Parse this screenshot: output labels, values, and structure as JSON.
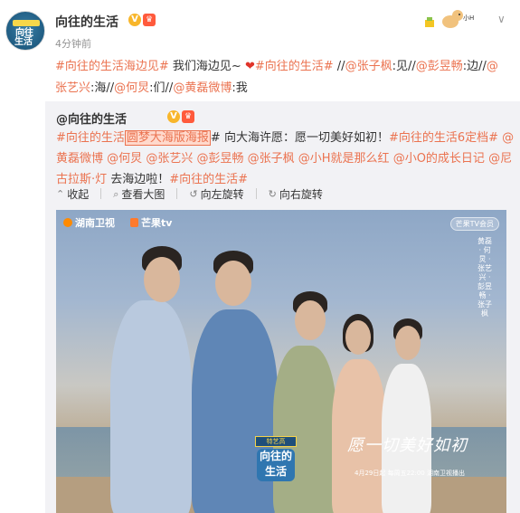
{
  "post": {
    "author": "向往的生活",
    "time": "4分钟前",
    "text": [
      {
        "t": "#向往的生活海边见#",
        "link": true
      },
      {
        "t": " 我们海边见~ ",
        "link": false
      },
      {
        "t": "❤",
        "heart": true
      },
      {
        "t": "#向往的生活#",
        "link": true
      },
      {
        "t": " //",
        "link": false
      },
      {
        "t": "@张子枫",
        "link": true
      },
      {
        "t": ":见//",
        "link": false
      },
      {
        "t": "@彭昱畅",
        "link": true
      },
      {
        "t": ":边//",
        "link": false
      },
      {
        "t": "@张艺兴",
        "link": true
      },
      {
        "t": ":海//",
        "link": false
      },
      {
        "t": "@何炅",
        "link": true
      },
      {
        "t": ":们//",
        "link": false
      },
      {
        "t": "@黄磊微博",
        "link": true
      },
      {
        "t": ":我",
        "link": false
      }
    ],
    "avatar_text": [
      "向往",
      "生活"
    ],
    "avatar_tag": "特艺高"
  },
  "repost": {
    "author": "@向往的生活",
    "body": [
      {
        "t": "#向往的生活",
        "link": true
      },
      {
        "t": "圆梦大海版海报",
        "hl": true
      },
      {
        "t": "# 向大海许愿：愿一切美好如初！",
        "link": false
      },
      {
        "t": "#向往的生活6定档#",
        "link": true
      },
      {
        "t": " ",
        "link": false
      },
      {
        "t": "@黄磊微博",
        "link": true
      },
      {
        "t": " ",
        "link": false
      },
      {
        "t": "@何炅",
        "link": true
      },
      {
        "t": " ",
        "link": false
      },
      {
        "t": "@张艺兴",
        "link": true
      },
      {
        "t": " ",
        "link": false
      },
      {
        "t": "@彭昱畅",
        "link": true
      },
      {
        "t": " ",
        "link": false
      },
      {
        "t": "@张子枫",
        "link": true
      },
      {
        "t": " ",
        "link": false
      },
      {
        "t": "@小H就是那么红",
        "link": true
      },
      {
        "t": " ",
        "link": false
      },
      {
        "t": "@小O的成长日记",
        "link": true
      },
      {
        "t": " ",
        "link": false
      },
      {
        "t": "@尼古拉斯·灯",
        "link": true
      },
      {
        "t": " 去海边啦！",
        "link": false
      },
      {
        "t": "#向往的生活#",
        "link": true
      }
    ],
    "tools": {
      "collapse": "收起",
      "view_large": "查看大图",
      "rotate_left": "向左旋转",
      "rotate_right": "向右旋转"
    }
  },
  "poster": {
    "channel_logo": "湖南卫视",
    "app_logo": "芒果tv",
    "corner_logo": "芒果TV会员",
    "credits": "黄磊 · 何炅 · 张艺兴 · 彭昱畅 · 张子枫",
    "slogan": "愿一切美好如初",
    "date_line": "4月29日起 每周五22:00 湖南卫视播出",
    "show_badge_top": "特艺高",
    "show_badge_text": "向往的生活"
  },
  "colors": {
    "link": "#eb7350",
    "card_bg": "#f2f2f5",
    "verified": "#f8b62b"
  }
}
